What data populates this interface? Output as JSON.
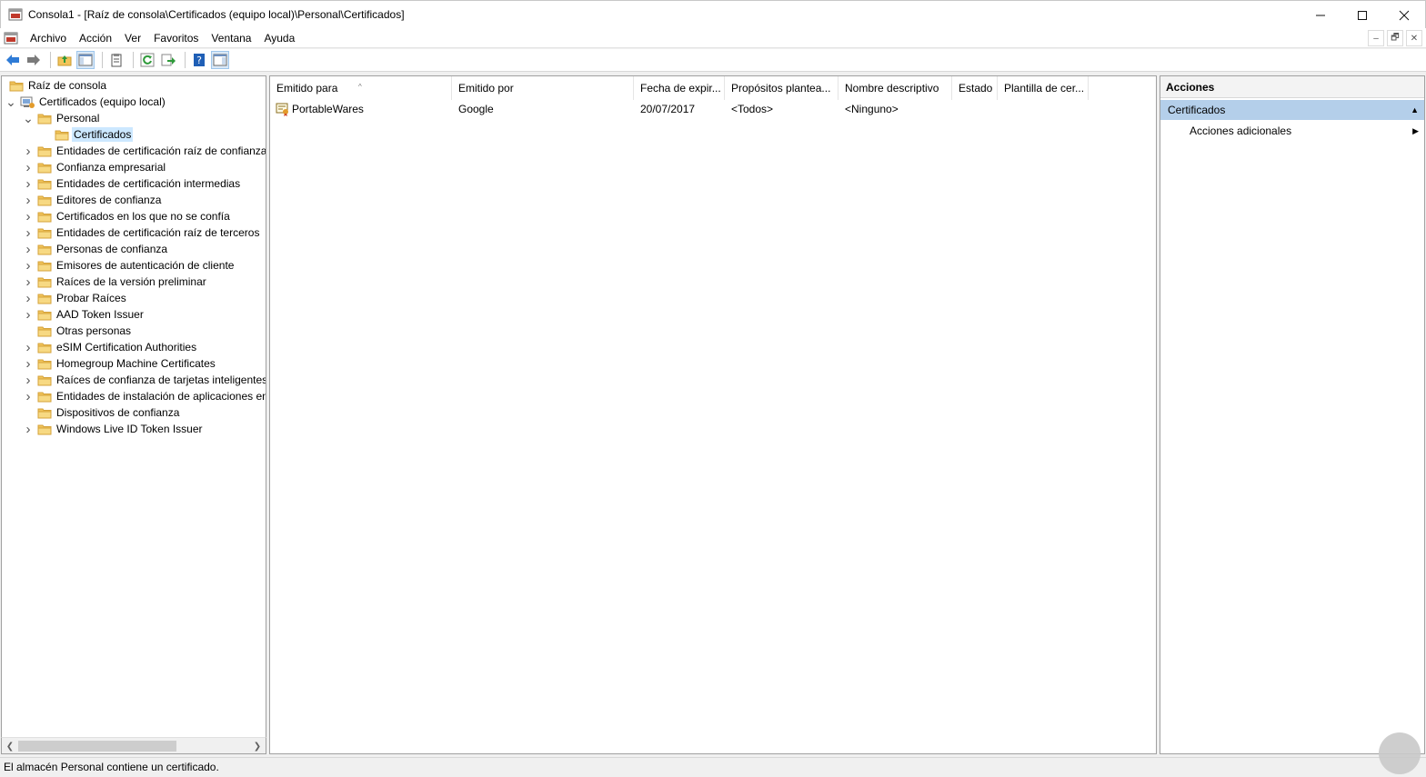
{
  "window": {
    "title": "Consola1 - [Raíz de consola\\Certificados (equipo local)\\Personal\\Certificados]",
    "icons": {
      "app": "mmc-console-icon",
      "minimize": "minimize-icon",
      "maximize": "maximize-icon",
      "close": "close-icon"
    }
  },
  "menubar": {
    "items": [
      "Archivo",
      "Acción",
      "Ver",
      "Favoritos",
      "Ventana",
      "Ayuda"
    ],
    "mdi_buttons": [
      "–",
      "🗗",
      "✕"
    ]
  },
  "toolbar": {
    "buttons": [
      "back-arrow-icon",
      "forward-arrow-icon",
      "up-folder-icon",
      "show-hide-tree-icon",
      "properties-icon",
      "refresh-icon",
      "export-list-icon",
      "help-icon",
      "show-hide-actions-icon"
    ]
  },
  "tree": {
    "items": [
      {
        "label": "Raíz de consola",
        "level": 0,
        "expander": ""
      },
      {
        "label": "Certificados (equipo local)",
        "level": 0,
        "expander": "open"
      },
      {
        "label": "Personal",
        "level": 1,
        "expander": "open"
      },
      {
        "label": "Certificados",
        "level": 2,
        "expander": "",
        "selected": true
      },
      {
        "label": "Entidades de certificación raíz de confianza",
        "level": 1,
        "expander": "closed"
      },
      {
        "label": "Confianza empresarial",
        "level": 1,
        "expander": "closed"
      },
      {
        "label": "Entidades de certificación intermedias",
        "level": 1,
        "expander": "closed"
      },
      {
        "label": "Editores de confianza",
        "level": 1,
        "expander": "closed"
      },
      {
        "label": "Certificados en los que no se confía",
        "level": 1,
        "expander": "closed"
      },
      {
        "label": "Entidades de certificación raíz de terceros",
        "level": 1,
        "expander": "closed"
      },
      {
        "label": "Personas de confianza",
        "level": 1,
        "expander": "closed"
      },
      {
        "label": "Emisores de autenticación de cliente",
        "level": 1,
        "expander": "closed"
      },
      {
        "label": "Raíces de la versión preliminar",
        "level": 1,
        "expander": "closed"
      },
      {
        "label": "Probar Raíces",
        "level": 1,
        "expander": "closed"
      },
      {
        "label": "AAD Token Issuer",
        "level": 1,
        "expander": "closed"
      },
      {
        "label": "Otras personas",
        "level": 1,
        "expander": ""
      },
      {
        "label": "eSIM Certification Authorities",
        "level": 1,
        "expander": "closed"
      },
      {
        "label": "Homegroup Machine Certificates",
        "level": 1,
        "expander": "closed"
      },
      {
        "label": "Raíces de confianza de tarjetas inteligentes",
        "level": 1,
        "expander": "closed"
      },
      {
        "label": "Entidades de instalación de aplicaciones en",
        "level": 1,
        "expander": "closed"
      },
      {
        "label": "Dispositivos de confianza",
        "level": 1,
        "expander": ""
      },
      {
        "label": "Windows Live ID Token Issuer",
        "level": 1,
        "expander": "closed"
      }
    ]
  },
  "list": {
    "columns": [
      "Emitido para",
      "Emitido por",
      "Fecha de expir...",
      "Propósitos plantea...",
      "Nombre descriptivo",
      "Estado",
      "Plantilla de cer..."
    ],
    "sort_indicator": "^",
    "rows": [
      [
        "PortableWares",
        "Google",
        "20/07/2017",
        "<Todos>",
        "<Ninguno>",
        "",
        ""
      ]
    ]
  },
  "actions": {
    "title": "Acciones",
    "section": "Certificados",
    "items": [
      "Acciones adicionales"
    ]
  },
  "status": {
    "text": "El almacén Personal contiene un certificado."
  },
  "colors": {
    "selection": "#cce8ff",
    "actions_section": "#b4cfea",
    "folder": "#f2c45a"
  }
}
